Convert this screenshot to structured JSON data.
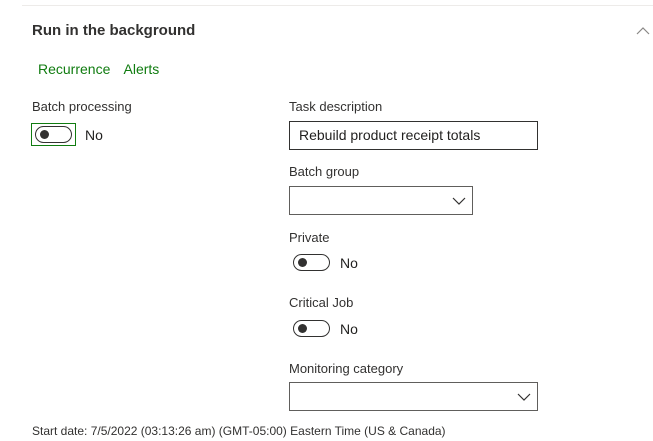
{
  "section": {
    "title": "Run in the background"
  },
  "links": {
    "recurrence": "Recurrence",
    "alerts": "Alerts"
  },
  "batch_processing": {
    "label": "Batch processing",
    "value": "No"
  },
  "task_description": {
    "label": "Task description",
    "value": "Rebuild product receipt totals"
  },
  "batch_group": {
    "label": "Batch group",
    "value": ""
  },
  "private": {
    "label": "Private",
    "value": "No"
  },
  "critical_job": {
    "label": "Critical Job",
    "value": "No"
  },
  "monitoring_category": {
    "label": "Monitoring category",
    "value": ""
  },
  "footer": {
    "start_date": "Start date: 7/5/2022 (03:13:26 am) (GMT-05:00) Eastern Time (US & Canada)"
  },
  "colors": {
    "accent_green": "#107c10",
    "text": "#201f1e",
    "border": "#605e5c"
  }
}
